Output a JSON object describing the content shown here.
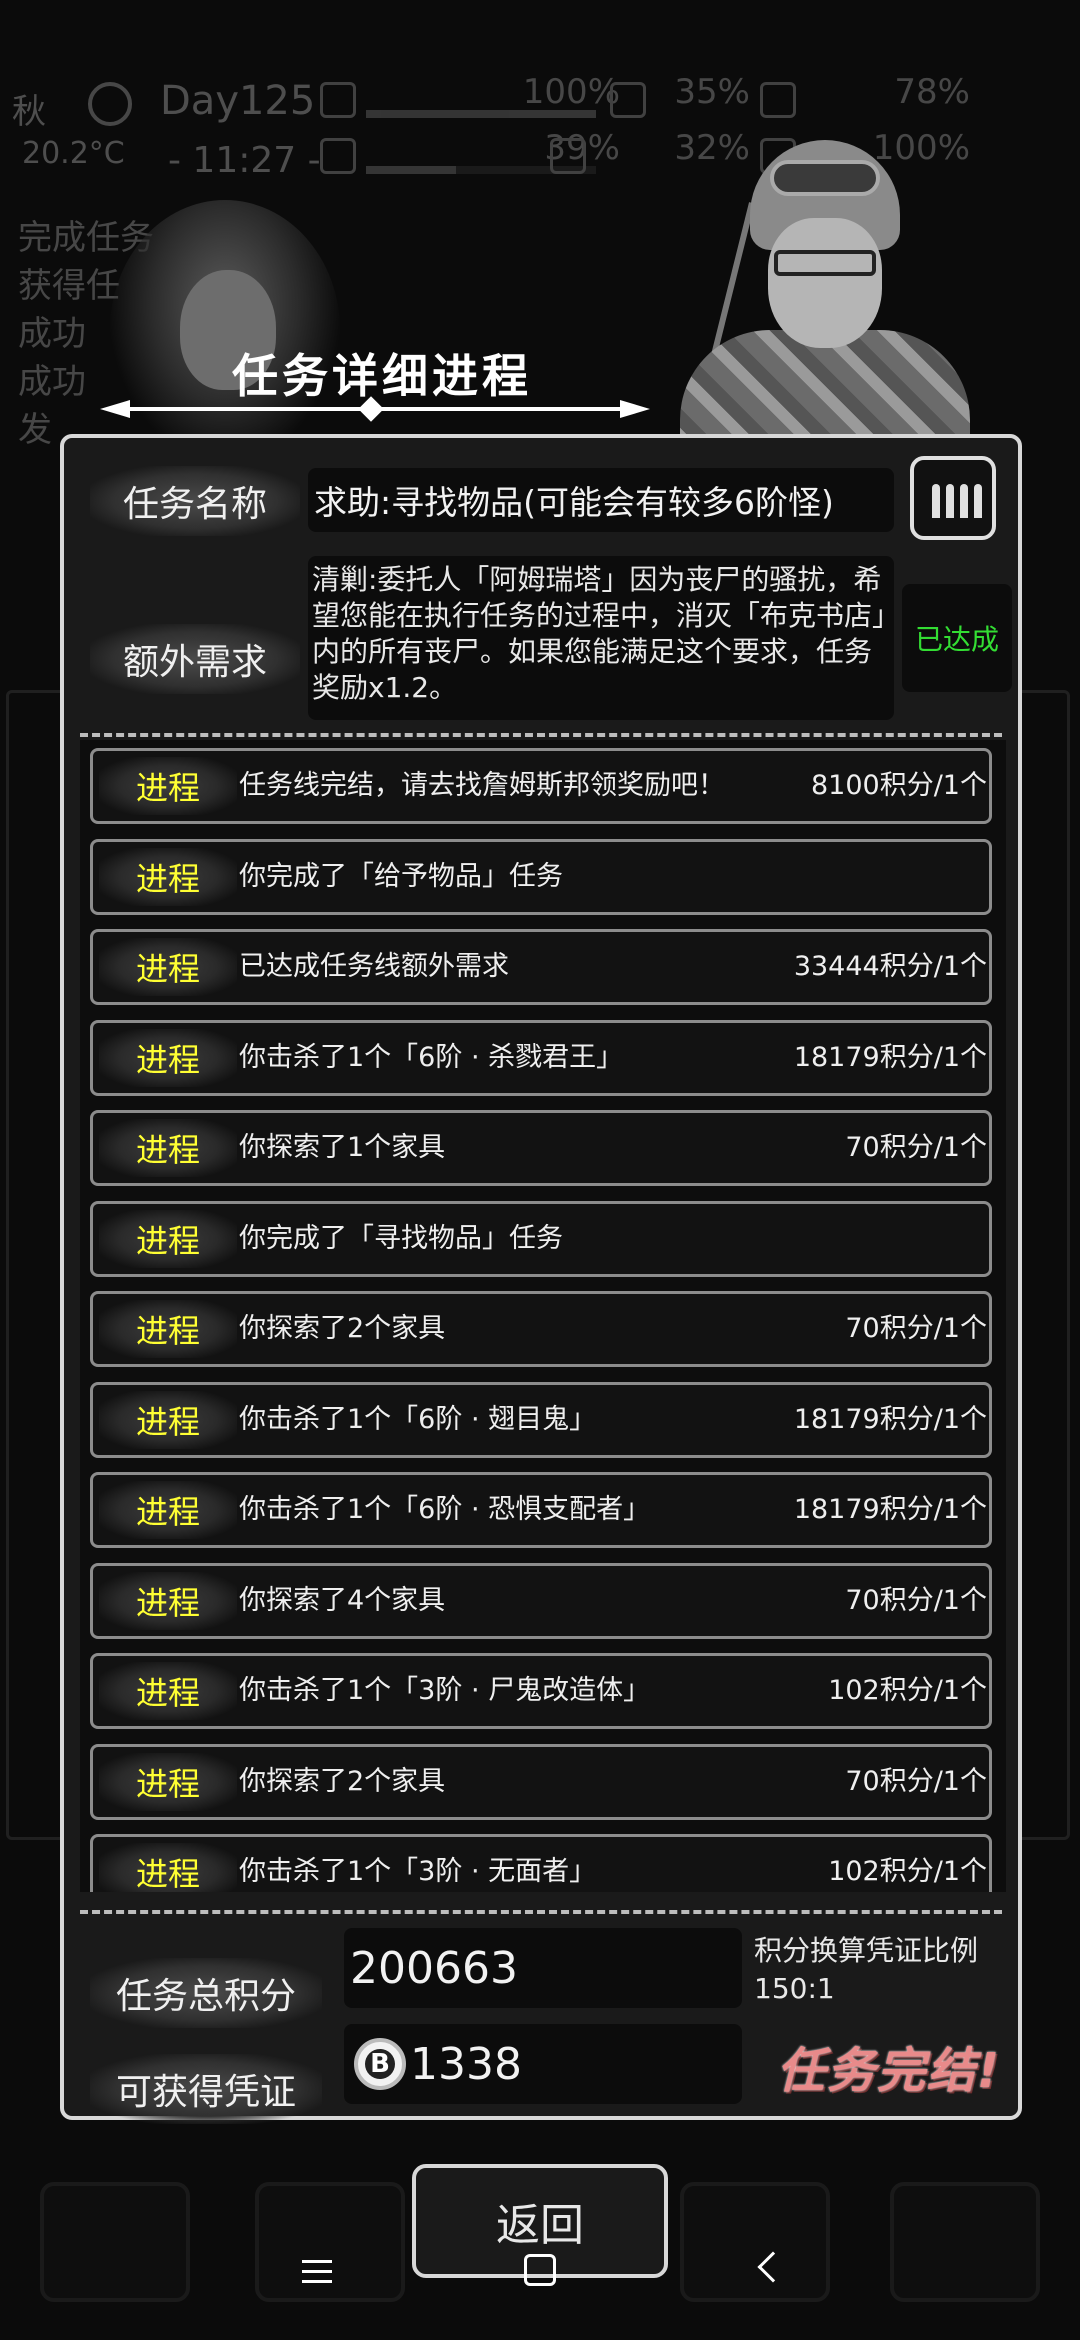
{
  "background": {
    "season": "秋",
    "temperature": "20.2°C",
    "day": "Day125",
    "clock": "- 11:27 -",
    "stats": [
      {
        "icon": "medkit-icon",
        "percent": "100%",
        "level": 1.0
      },
      {
        "icon": "stomach-icon",
        "percent": "35%",
        "level": 0.35
      },
      {
        "icon": "energy-icon",
        "percent": "78%",
        "level": 0.78
      },
      {
        "icon": "boot-icon",
        "percent": "39%",
        "level": 0.39
      },
      {
        "icon": "water-drop-icon",
        "percent": "32%",
        "level": 0.32
      },
      {
        "icon": "mood-icon",
        "percent": "100%",
        "level": 1.0
      }
    ],
    "quest_lines": [
      "完成任务",
      "获得任",
      "成功",
      "成功",
      "发"
    ]
  },
  "panel": {
    "title": "任务详细进程"
  },
  "quest": {
    "name_label": "任务名称",
    "name_value": "求助:寻找物品(可能会有较多6阶怪)",
    "extra_label": "额外需求",
    "extra_desc": "清剿:委托人「阿姆瑞塔」因为丧尸的骚扰，希望您能在执行任务的过程中，消灭「布克书店」内的所有丧尸。如果您能满足这个要求，任务奖励x1.2。",
    "extra_status": "已达成"
  },
  "progress": [
    {
      "tag": "进程",
      "desc": "任务线完结，请去找詹姆斯邦领奖励吧！",
      "points": "8100积分/1个"
    },
    {
      "tag": "进程",
      "desc": "你完成了「给予物品」任务",
      "points": ""
    },
    {
      "tag": "进程",
      "desc": "已达成任务线额外需求",
      "points": "33444积分/1个"
    },
    {
      "tag": "进程",
      "desc": "你击杀了1个「6阶 · 杀戮君王」",
      "points": "18179积分/1个"
    },
    {
      "tag": "进程",
      "desc": "你探索了1个家具",
      "points": "70积分/1个"
    },
    {
      "tag": "进程",
      "desc": "你完成了「寻找物品」任务",
      "points": ""
    },
    {
      "tag": "进程",
      "desc": "你探索了2个家具",
      "points": "70积分/1个"
    },
    {
      "tag": "进程",
      "desc": "你击杀了1个「6阶 · 翅目鬼」",
      "points": "18179积分/1个"
    },
    {
      "tag": "进程",
      "desc": "你击杀了1个「6阶 · 恐惧支配者」",
      "points": "18179积分/1个"
    },
    {
      "tag": "进程",
      "desc": "你探索了4个家具",
      "points": "70积分/1个"
    },
    {
      "tag": "进程",
      "desc": "你击杀了1个「3阶 · 尸鬼改造体」",
      "points": "102积分/1个"
    },
    {
      "tag": "进程",
      "desc": "你探索了2个家具",
      "points": "70积分/1个"
    },
    {
      "tag": "进程",
      "desc": "你击杀了1个「3阶 · 无面者」",
      "points": "102积分/1个"
    }
  ],
  "summary": {
    "total_label": "任务总积分",
    "total_value": "200663",
    "ratio_label": "积分换算凭证比例",
    "ratio_value": "150:1",
    "credential_label": "可获得凭证",
    "coin_symbol": "B",
    "credential_value": "1338",
    "complete_label": "任务完结!"
  },
  "footer": {
    "return_label": "返回"
  }
}
